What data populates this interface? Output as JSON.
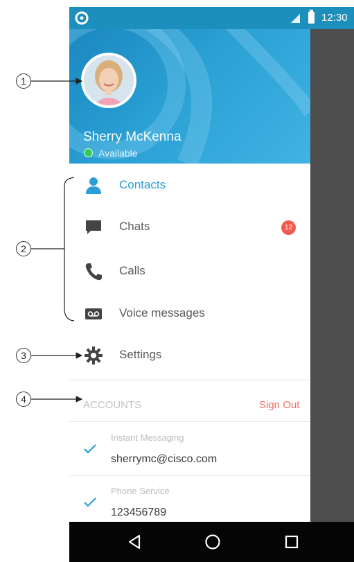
{
  "status_bar": {
    "time": "12:30"
  },
  "profile": {
    "name": "Sherry McKenna",
    "presence": "Available",
    "presence_color": "#2fce5a"
  },
  "menu": {
    "contacts": "Contacts",
    "chats": "Chats",
    "chats_badge": "12",
    "calls": "Calls",
    "voice_messages": "Voice messages",
    "settings": "Settings"
  },
  "accounts": {
    "title": "ACCOUNTS",
    "sign_out": "Sign Out",
    "items": [
      {
        "service": "Instant Messaging",
        "value": "sherrymc@cisco.com",
        "checked": true
      },
      {
        "service": "Phone Service",
        "value": "123456789",
        "checked": true
      }
    ]
  },
  "callouts": [
    "1",
    "2",
    "3",
    "4"
  ],
  "colors": {
    "accent": "#2a9fd6",
    "header": "#1d8fbd",
    "badge": "#f05b4f",
    "sign_out": "#f26a5a"
  },
  "icons": {
    "app": "jabber-logo-icon",
    "contacts": "person-icon",
    "chats": "chat-bubble-icon",
    "calls": "phone-icon",
    "voice": "voicemail-icon",
    "settings": "gear-icon",
    "check": "checkmark-icon",
    "back": "back-triangle-icon",
    "home": "home-circle-icon",
    "recents": "recents-square-icon"
  }
}
